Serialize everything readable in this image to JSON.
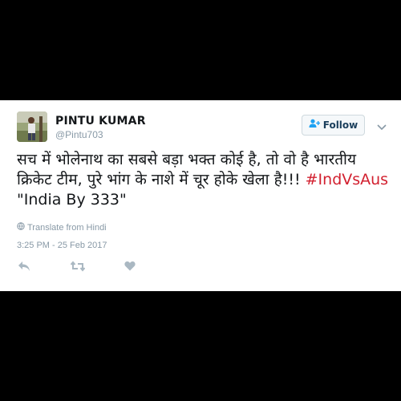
{
  "tweet": {
    "author_name": "PINTU KUMAR",
    "handle": "@Pintu703",
    "text_main": "सच में भोलेनाथ का सबसे बड़ा भक्त कोई है, तो वो है भारतीय क्रिकेट टीम, पुरे भांग के नाशे में चूर होके खेला है!!! ",
    "hashtag": "#IndVsAus",
    "text_tail": " \"India By 333\"",
    "translate_label": "Translate from Hindi",
    "timestamp": "3:25 PM - 25 Feb 2017"
  },
  "follow_button": {
    "label": "Follow"
  },
  "actions": [
    "reply-icon",
    "retweet-icon",
    "like-icon"
  ],
  "colors": {
    "background": "#000000",
    "card": "#ffffff",
    "hashtag": "#d2202f",
    "meta_text": "#8899a6",
    "follow_text": "#1b3f5c"
  }
}
